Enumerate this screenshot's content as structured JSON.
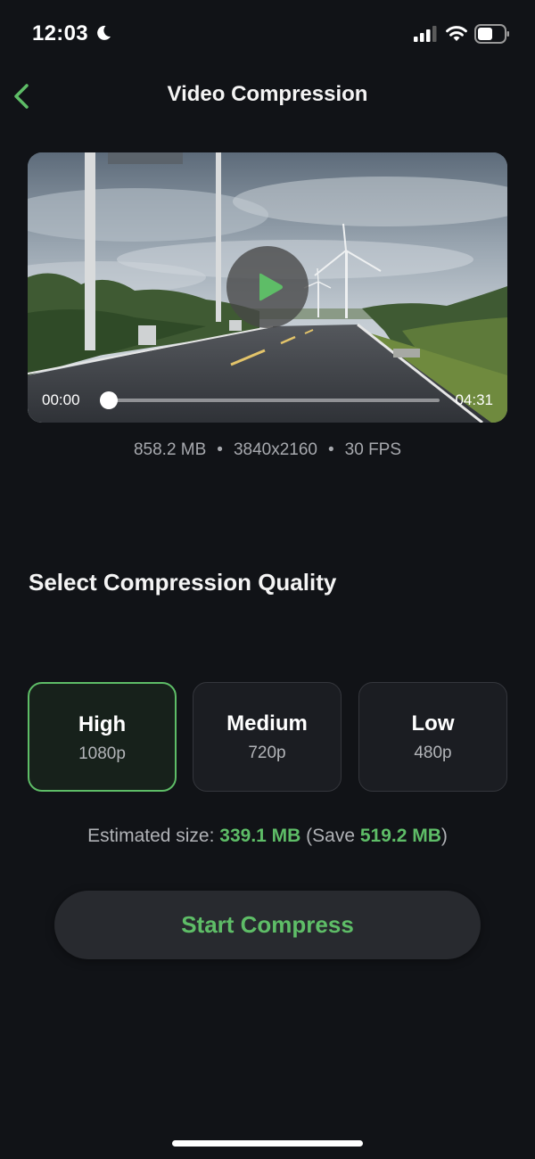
{
  "status_bar": {
    "time": "12:03",
    "icons": [
      "moon-icon",
      "signal-icon",
      "wifi-icon",
      "battery-icon"
    ]
  },
  "nav": {
    "title": "Video Compression",
    "back_icon": "chevron-left-icon"
  },
  "video": {
    "current_time": "00:00",
    "total_time": "04:31",
    "progress": 0,
    "play_icon": "play-icon"
  },
  "video_meta": {
    "size": "858.2 MB",
    "resolution": "3840x2160",
    "fps": "30 FPS",
    "separator": "•"
  },
  "quality": {
    "title": "Select Compression Quality",
    "options": [
      {
        "label": "High",
        "resolution": "1080p",
        "selected": true
      },
      {
        "label": "Medium",
        "resolution": "720p",
        "selected": false
      },
      {
        "label": "Low",
        "resolution": "480p",
        "selected": false
      }
    ]
  },
  "estimate": {
    "prefix": "Estimated size: ",
    "size": "339.1 MB",
    "save_prefix": " (Save ",
    "save": "519.2 MB",
    "suffix": ")"
  },
  "action": {
    "start_label": "Start Compress"
  },
  "colors": {
    "background": "#111317",
    "accent": "#5ebd67",
    "card": "#1b1d22",
    "selected_card": "#17211b",
    "button": "#282a2f"
  }
}
